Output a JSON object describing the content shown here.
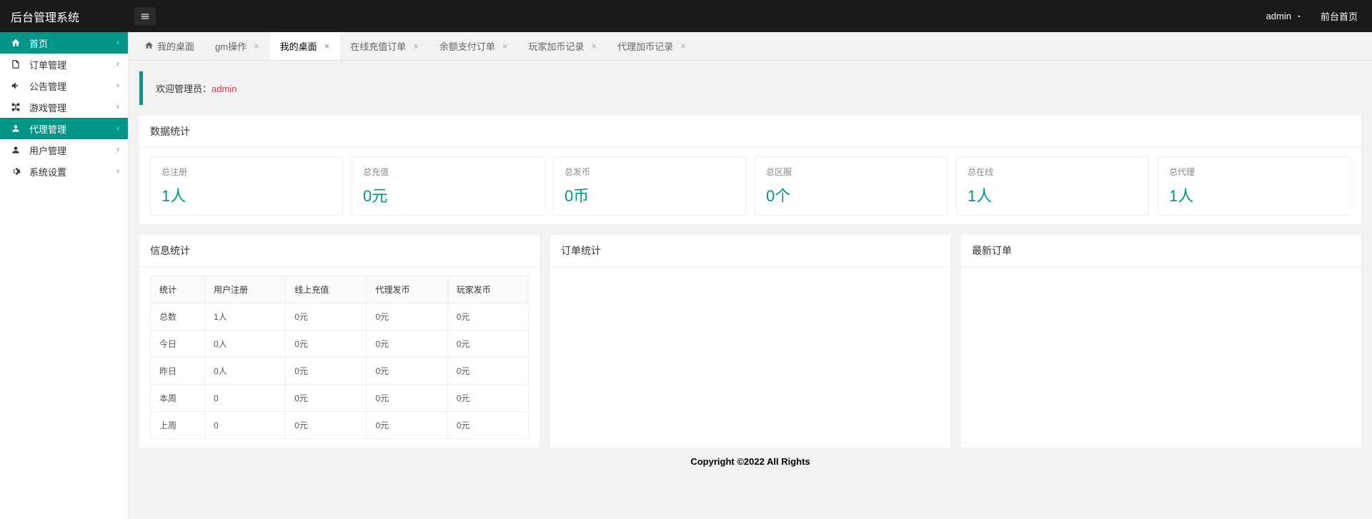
{
  "brand": "后台管理系统",
  "topbar": {
    "user": "admin",
    "front_link": "前台首页"
  },
  "sidebar": [
    {
      "label": "首页",
      "icon": "home",
      "active": true
    },
    {
      "label": "订单管理",
      "icon": "doc"
    },
    {
      "label": "公告管理",
      "icon": "speaker"
    },
    {
      "label": "游戏管理",
      "icon": "tree"
    },
    {
      "label": "代理管理",
      "icon": "user",
      "active": true
    },
    {
      "label": "用户管理",
      "icon": "user"
    },
    {
      "label": "系统设置",
      "icon": "gear"
    }
  ],
  "tabs": [
    {
      "label": "我的桌面",
      "home": true
    },
    {
      "label": "gm操作"
    },
    {
      "label": "我的桌面",
      "active": true
    },
    {
      "label": "在线充值订单"
    },
    {
      "label": "余额支付订单"
    },
    {
      "label": "玩家加币记录"
    },
    {
      "label": "代理加币记录"
    }
  ],
  "welcome": {
    "prefix": "欢迎管理员：",
    "user": "admin"
  },
  "stats_title": "数据统计",
  "stats": [
    {
      "label": "总注册",
      "value": "1人"
    },
    {
      "label": "总充值",
      "value": "0元"
    },
    {
      "label": "总发币",
      "value": "0币"
    },
    {
      "label": "总区服",
      "value": "0个"
    },
    {
      "label": "总在线",
      "value": "1人"
    },
    {
      "label": "总代理",
      "value": "1人"
    }
  ],
  "info_title": "信息统计",
  "order_stats_title": "订单统计",
  "latest_orders_title": "最新订单",
  "info_headers": [
    "统计",
    "用户注册",
    "线上充值",
    "代理发币",
    "玩家发币"
  ],
  "info_rows": [
    [
      "总数",
      "1人",
      "0元",
      "0元",
      "0元"
    ],
    [
      "今日",
      "0人",
      "0元",
      "0元",
      "0元"
    ],
    [
      "昨日",
      "0人",
      "0元",
      "0元",
      "0元"
    ],
    [
      "本周",
      "0",
      "0元",
      "0元",
      "0元"
    ],
    [
      "上周",
      "0",
      "0元",
      "0元",
      "0元"
    ]
  ],
  "footer": "Copyright ©2022 All Rights"
}
